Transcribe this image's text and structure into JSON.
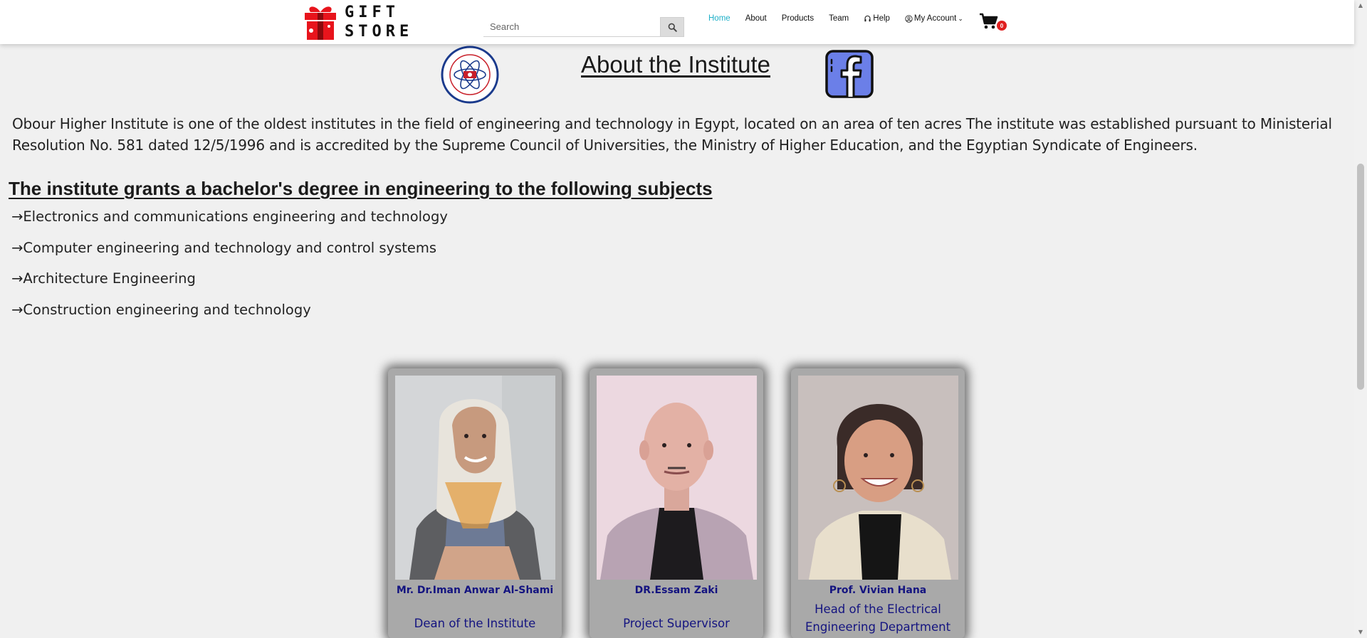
{
  "brand": {
    "line1": "GIFT",
    "line2": "STORE"
  },
  "search": {
    "placeholder": "Search",
    "value": ""
  },
  "nav": {
    "items": [
      {
        "label": "Home",
        "active": true
      },
      {
        "label": "About"
      },
      {
        "label": "Products"
      },
      {
        "label": "Team"
      },
      {
        "label": "Help",
        "icon": "headset-icon"
      },
      {
        "label": "My Account",
        "icon": "user-circle-icon"
      }
    ]
  },
  "cart": {
    "count": "0"
  },
  "about": {
    "title": "About the Institute",
    "text": "Obour Higher Institute is one of the oldest institutes in the field of engineering and technology in Egypt, located on an area of ten acres The institute was established pursuant to Ministerial Resolution No. 581 dated 12/5/1996 and is accredited by the Supreme Council of Universities, the Ministry of Higher Education, and the Egyptian Syndicate of Engineers."
  },
  "subjects": {
    "heading": "The institute grants a bachelor's degree in engineering to the following subjects",
    "items": [
      "→Electronics and communications engineering and technology",
      "→Computer engineering and technology and control systems",
      "→Architecture Engineering",
      "→Construction engineering and technology"
    ]
  },
  "staff": [
    {
      "name": "Mr. Dr.Iman Anwar Al-Shami",
      "role": "Dean of the Institute"
    },
    {
      "name": "DR.Essam Zaki",
      "role": "Project Supervisor"
    },
    {
      "name": "Prof. Vivian Hana",
      "role": "Head of the Electrical Engineering Department"
    }
  ],
  "colors": {
    "accent": "#1fb0c8",
    "staff_text": "#141480",
    "badge": "#e02020",
    "card_bg": "#a9a9a9",
    "fb_blue": "#6b7fe8"
  }
}
